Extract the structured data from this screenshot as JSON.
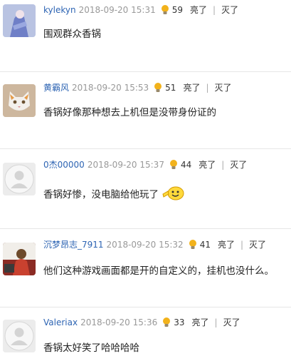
{
  "comments": [
    {
      "user": "kylekyn",
      "time": "2018-09-20 15:31",
      "likes": "59",
      "light": "亮了",
      "dim": "灭了",
      "text": "围观群众香锅",
      "avatar": "avatar-blue-figure"
    },
    {
      "user": "黄霸风",
      "time": "2018-09-20 15:53",
      "likes": "51",
      "light": "亮了",
      "dim": "灭了",
      "text": "香锅好像那种想去上机但是没带身份证的",
      "avatar": "avatar-cat"
    },
    {
      "user": "0杰00000",
      "time": "2018-09-20 15:37",
      "likes": "44",
      "light": "亮了",
      "dim": "灭了",
      "text": "香锅好惨，没电脑给他玩了",
      "avatar": "avatar-default"
    },
    {
      "user": "沉梦昂志_7911",
      "time": "2018-09-20 15:32",
      "likes": "41",
      "light": "亮了",
      "dim": "灭了",
      "text": "他们这种游戏画面都是开的自定义的，挂机也没什么。",
      "avatar": "avatar-player"
    },
    {
      "user": "Valeriax",
      "time": "2018-09-20 15:36",
      "likes": "33",
      "light": "亮了",
      "dim": "灭了",
      "text": "香锅太好笑了哈哈哈哈",
      "avatar": "avatar-default"
    }
  ],
  "icons": {
    "like": "lightbulb-icon",
    "emoji": "waving-smiley-emoji"
  },
  "colors": {
    "username": "#2d64b3",
    "timestamp": "#999999",
    "divider": "#e6e6e6",
    "bulb": "#f2b21b"
  }
}
